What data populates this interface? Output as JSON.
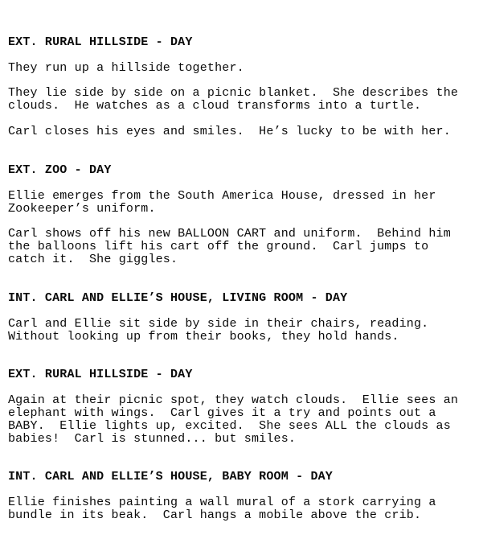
{
  "document": {
    "type": "screenplay-page",
    "font": "typewriter-monospace",
    "text_color": "#0a0a0a",
    "background_color": "#ffffff"
  },
  "scenes": [
    {
      "slugline": "EXT. RURAL HILLSIDE - DAY",
      "paragraphs": [
        {
          "lines": [
            "They run up a hillside together."
          ]
        },
        {
          "lines": [
            "They lie side by side on a picnic blanket.  She describes the",
            "clouds.  He watches as a cloud transforms into a turtle."
          ]
        },
        {
          "lines": [
            "Carl closes his eyes and smiles.  He’s lucky to be with her."
          ]
        }
      ]
    },
    {
      "slugline": "EXT. ZOO - DAY",
      "paragraphs": [
        {
          "lines": [
            "Ellie emerges from the South America House, dressed in her",
            "Zookeeper’s uniform."
          ]
        },
        {
          "lines": [
            "Carl shows off his new BALLOON CART and uniform.  Behind him",
            "the balloons lift his cart off the ground.  Carl jumps to",
            "catch it.  She giggles."
          ]
        }
      ]
    },
    {
      "slugline": "INT. CARL AND ELLIE’S HOUSE, LIVING ROOM - DAY",
      "paragraphs": [
        {
          "lines": [
            "Carl and Ellie sit side by side in their chairs, reading.",
            "Without looking up from their books, they hold hands."
          ]
        }
      ]
    },
    {
      "slugline": "EXT. RURAL HILLSIDE - DAY",
      "paragraphs": [
        {
          "lines": [
            "Again at their picnic spot, they watch clouds.  Ellie sees an",
            "elephant with wings.  Carl gives it a try and points out a",
            "BABY.  Ellie lights up, excited.  She sees ALL the clouds as",
            "babies!  Carl is stunned... but smiles."
          ]
        }
      ]
    },
    {
      "slugline": "INT. CARL AND ELLIE’S HOUSE, BABY ROOM - DAY",
      "paragraphs": [
        {
          "lines": [
            "Ellie finishes painting a wall mural of a stork carrying a",
            "bundle in its beak.  Carl hangs a mobile above the crib."
          ]
        }
      ]
    }
  ]
}
